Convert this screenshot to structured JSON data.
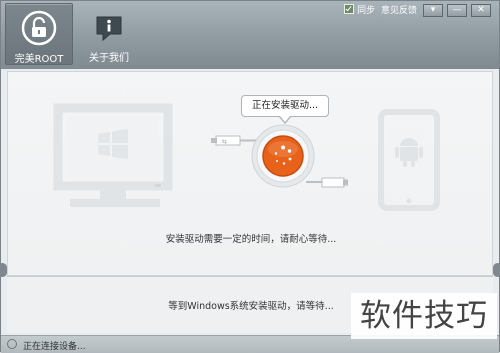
{
  "header": {
    "tabs": [
      {
        "label": "完美ROOT",
        "icon": "lock-icon",
        "active": true
      },
      {
        "label": "关于我们",
        "icon": "info-icon",
        "active": false
      }
    ],
    "feedback": {
      "checkbox_label": "同步",
      "link": "意见反馈"
    },
    "window_controls": {
      "dropdown": "▾",
      "minimize": "—",
      "close": "✕"
    }
  },
  "main": {
    "bubble_text": "正在安装驱动...",
    "status_text": "安装驱动需要一定的时间，请耐心等待..."
  },
  "lower": {
    "status_text": "等到Windows系统安装驱动，请等待..."
  },
  "statusbar": {
    "text": "正在连接设备..."
  },
  "watermark": {
    "text": "软件技巧"
  },
  "colors": {
    "accent": "#e8621a",
    "topbar": "#8f9aa1"
  }
}
